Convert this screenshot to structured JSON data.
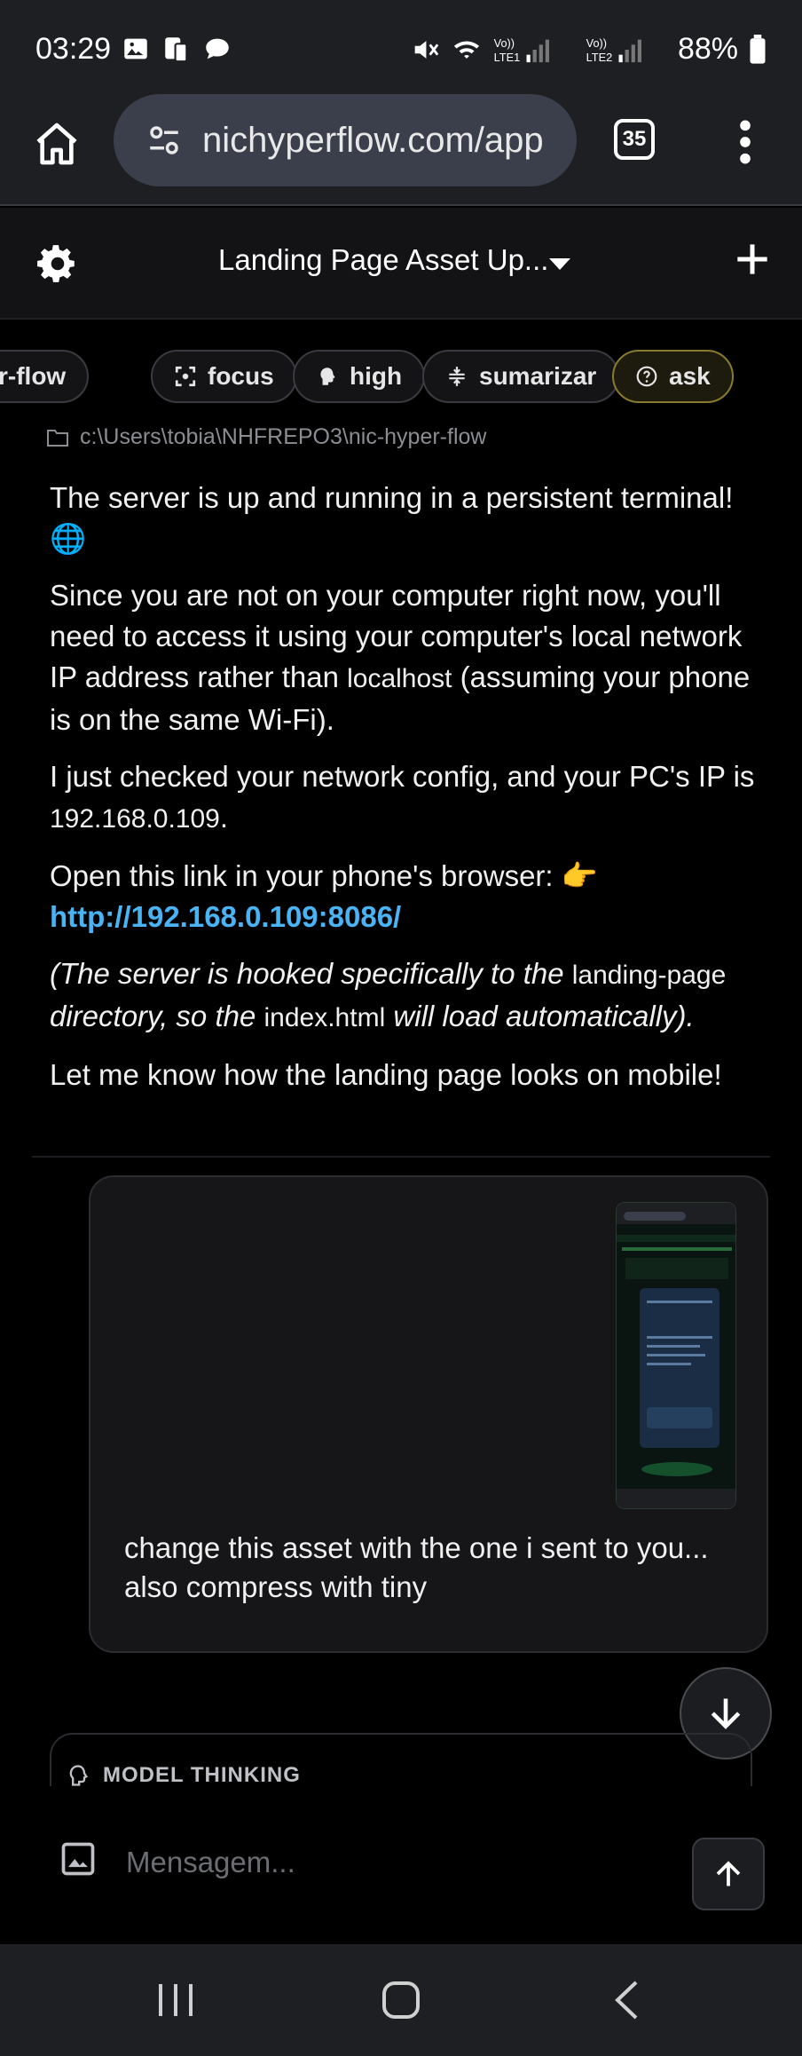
{
  "status_bar": {
    "time": "03:29",
    "battery": "88%",
    "network_labels": [
      "Vo)) LTE1",
      "Vo)) LTE2"
    ],
    "icons": [
      "image-icon",
      "phone-tablet-icon",
      "chat-bubble-icon",
      "mute-icon",
      "wifi-icon",
      "signal-icon",
      "battery-icon"
    ]
  },
  "browser": {
    "url": "nichyperflow.com/app",
    "tab_count": "35"
  },
  "header": {
    "title": "Landing Page Asset Up..."
  },
  "chips": [
    {
      "label": "r-flow",
      "icon": "flow-icon"
    },
    {
      "label": "focus",
      "icon": "focus-icon"
    },
    {
      "label": "high",
      "icon": "brain-icon"
    },
    {
      "label": "sumarizar",
      "icon": "compress-icon"
    },
    {
      "label": "ask",
      "icon": "question-icon"
    }
  ],
  "path": "c:\\Users\\tobia\\NHFREPO3\\nic-hyper-flow",
  "message": {
    "p1": "The server is up and running in a persistent terminal!",
    "p1_emoji": "🌐",
    "p2_a": "Since you are not on your computer right now, you'll need to access it using your computer's local network IP address rather than ",
    "p2_code": "localhost",
    "p2_b": " (assuming your phone is on the same Wi-Fi).",
    "p3_a": "I just checked your network config, and your PC's IP is ",
    "p3_code": "192.168.0.109",
    "p3_b": ".",
    "p4_a": "Open this link in your phone's browser: ",
    "p4_emoji": "👉",
    "p4_link": "http://192.168.0.109:8086/",
    "p5_a": "(The server is hooked specifically to the ",
    "p5_code1": "landing-page",
    "p5_b": " directory, so the ",
    "p5_code2": "index.html",
    "p5_c": " will load automatically).",
    "p6": "Let me know how the landing page looks on mobile!"
  },
  "user_message": {
    "text": "change this asset with the one i sent to you... also compress with tiny"
  },
  "thinking": {
    "label": "MODEL THINKING"
  },
  "input": {
    "placeholder": "Mensagem..."
  },
  "colors": {
    "accent_link": "#4ab3f4",
    "active_chip_border": "#8a7a2e",
    "background": "#000000",
    "bar": "#1e1f23"
  }
}
